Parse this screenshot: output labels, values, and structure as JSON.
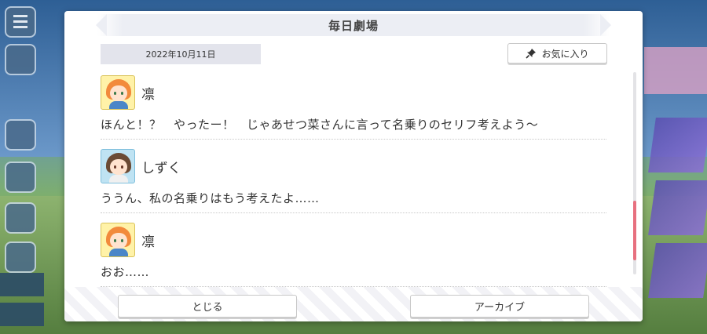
{
  "dialog": {
    "title": "毎日劇場",
    "date": "2022年10月11日",
    "favorite_label": "お気に入り",
    "close_label": "とじる",
    "archive_label": "アーカイブ"
  },
  "log": [
    {
      "speaker": "凛",
      "avatar": "rin",
      "text": "ほんと！？　やったー！　じゃあせつ菜さんに言って名乗りのセリフ考えよう〜"
    },
    {
      "speaker": "しずく",
      "avatar": "shizuku",
      "text": "ううん、私の名乗りはもう考えたよ……"
    },
    {
      "speaker": "凛",
      "avatar": "rin",
      "text": "おお……"
    }
  ],
  "colors": {
    "scroll_thumb": "#e7707f",
    "date_bg": "#e3e4ec",
    "rin_avatar_bg": "#fff2a8",
    "shizuku_avatar_bg": "#bfe3f3"
  },
  "icons": {
    "favorite": "pin-icon",
    "menu": "hamburger-icon"
  }
}
